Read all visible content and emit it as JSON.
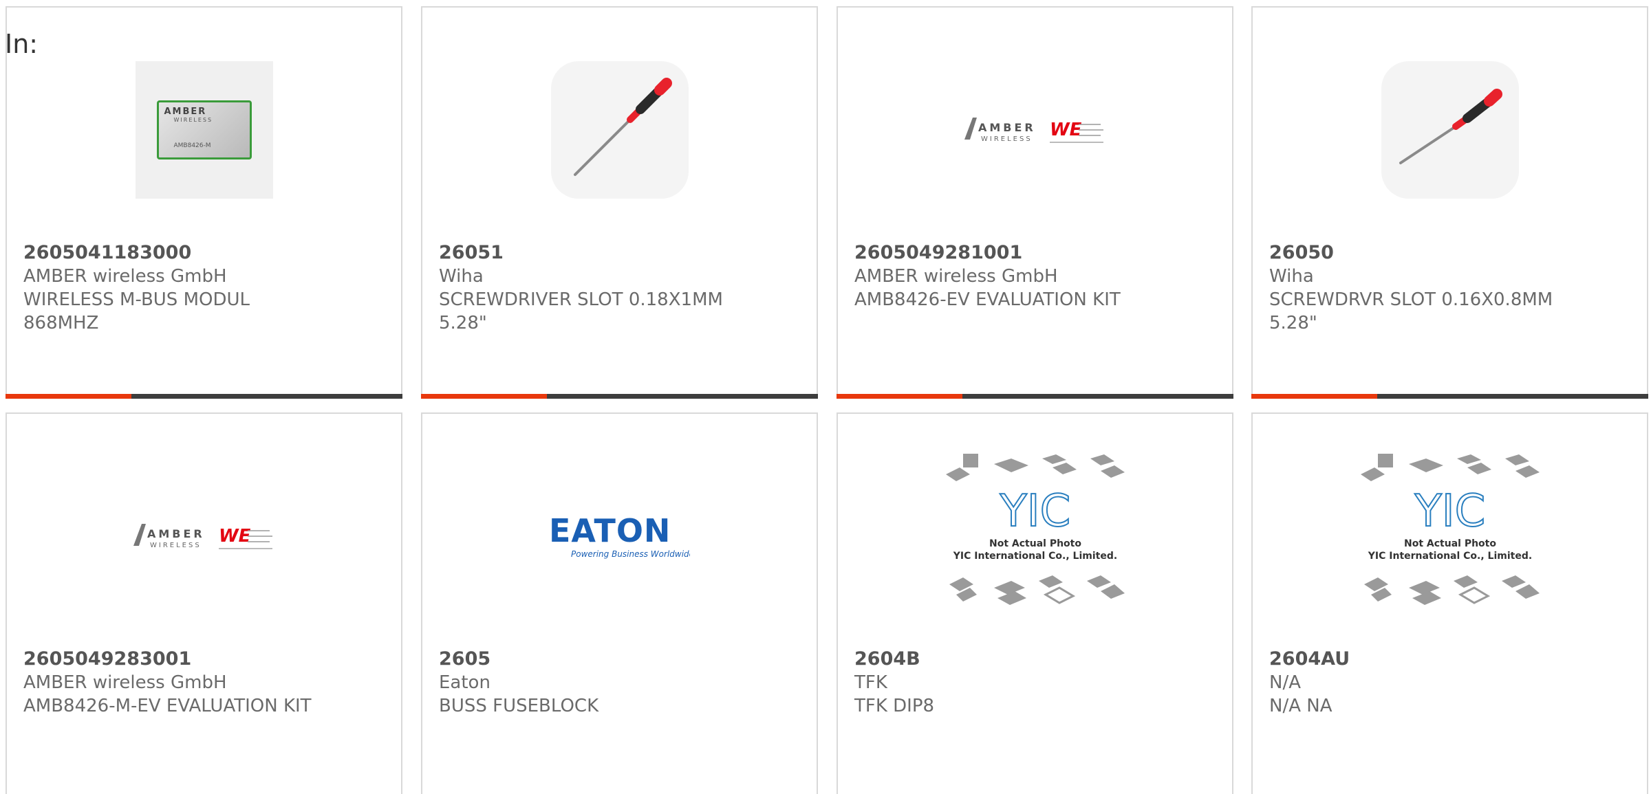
{
  "filter": {
    "label": "In:"
  },
  "products": [
    {
      "part_number": "2605041183000",
      "manufacturer": "AMBER wireless GmbH",
      "description_line1": "WIRELESS M-BUS MODUL",
      "description_line2": "868MHZ",
      "image": "amber-module-photo",
      "image_text": {
        "logo": "AMBER",
        "sub": "WIRELESS",
        "code": "AMB8426-M"
      }
    },
    {
      "part_number": "26051",
      "manufacturer": "Wiha",
      "description_line1": "SCREWDRIVER SLOT 0.18X1MM",
      "description_line2": "5.28\"",
      "image": "screwdriver-photo"
    },
    {
      "part_number": "2605049281001",
      "manufacturer": "AMBER wireless GmbH",
      "description_line1": "AMB8426-EV EVALUATION KIT",
      "description_line2": "",
      "image": "amber-we-logo",
      "image_text": {
        "logo": "AMBER",
        "sub": "WIRELESS",
        "mark": "WE"
      }
    },
    {
      "part_number": "26050",
      "manufacturer": "Wiha",
      "description_line1": "SCREWDRVR SLOT 0.16X0.8MM",
      "description_line2": "5.28\"",
      "image": "screwdriver-photo"
    },
    {
      "part_number": "2605049283001",
      "manufacturer": "AMBER wireless GmbH",
      "description_line1": "AMB8426-M-EV EVALUATION KIT",
      "description_line2": "",
      "image": "amber-we-logo",
      "image_text": {
        "logo": "AMBER",
        "sub": "WIRELESS",
        "mark": "WE"
      }
    },
    {
      "part_number": "2605",
      "manufacturer": "Eaton",
      "description_line1": "BUSS FUSEBLOCK",
      "description_line2": "",
      "image": "eaton-logo",
      "image_text": {
        "logo": "EATON",
        "tagline": "Powering Business Worldwide"
      }
    },
    {
      "part_number": "2604B",
      "manufacturer": "TFK",
      "description_line1": "TFK DIP8",
      "description_line2": "",
      "image": "yic-placeholder",
      "image_text": {
        "logo": "YIC",
        "line1": "Not Actual Photo",
        "line2": "YIC International Co., Limited."
      }
    },
    {
      "part_number": "2604AU",
      "manufacturer": "N/A",
      "description_line1": "N/A NA",
      "description_line2": "",
      "image": "yic-placeholder",
      "image_text": {
        "logo": "YIC",
        "line1": "Not Actual Photo",
        "line2": "YIC International Co., Limited."
      }
    }
  ],
  "colors": {
    "accent": "#e8380d",
    "bar": "#3d3d3d",
    "border": "#d9d9d9",
    "text": "#6a6a6a",
    "eaton_blue": "#1a5fb4",
    "we_red": "#e30613"
  }
}
